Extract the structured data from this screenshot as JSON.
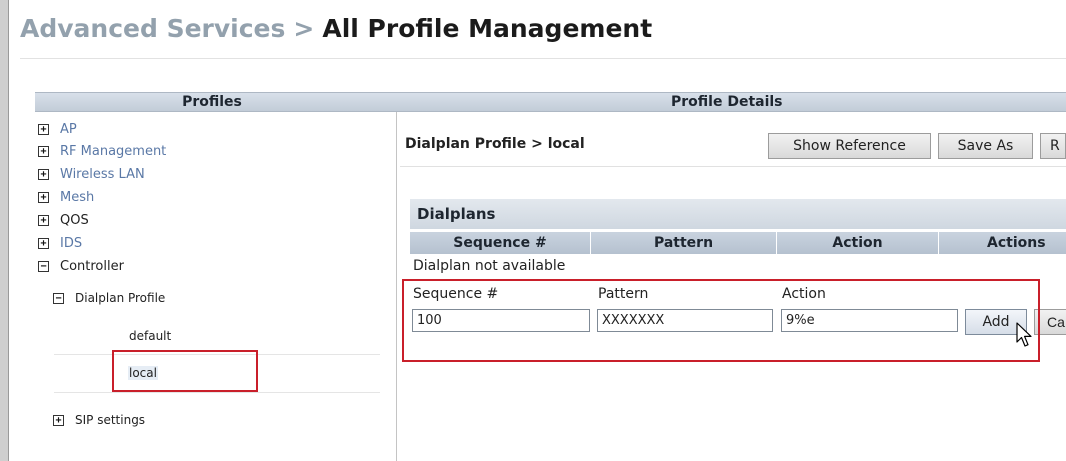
{
  "page": {
    "breadcrumb_parent": "Advanced Services",
    "breadcrumb_separator": ">",
    "title": "All Profile Management"
  },
  "profiles_panel": {
    "header": "Profiles",
    "tree": [
      {
        "label": "AP",
        "toggle": "+"
      },
      {
        "label": "RF Management",
        "toggle": "+"
      },
      {
        "label": "Wireless LAN",
        "toggle": "+"
      },
      {
        "label": "Mesh",
        "toggle": "+"
      },
      {
        "label": "QOS",
        "toggle": "+"
      },
      {
        "label": "IDS",
        "toggle": "+"
      },
      {
        "label": "Controller",
        "toggle": "−"
      }
    ],
    "dialplan_profile": {
      "label": "Dialplan Profile",
      "toggle": "−"
    },
    "dialplan_leaves": [
      "default",
      "local"
    ],
    "sip_settings": {
      "label": "SIP settings",
      "toggle": "+"
    }
  },
  "details_panel": {
    "header": "Profile Details",
    "profile_path": "Dialplan Profile > local",
    "buttons": {
      "show_reference": "Show Reference",
      "save_as": "Save As",
      "reset_partial": "R"
    },
    "section_title": "Dialplans",
    "columns": [
      "Sequence #",
      "Pattern",
      "Action",
      "Actions"
    ],
    "empty_message": "Dialplan not available",
    "form": {
      "sequence_label": "Sequence #",
      "pattern_label": "Pattern",
      "action_label": "Action",
      "sequence_value": "100",
      "pattern_value": "XXXXXXX",
      "action_value": "9%e",
      "add_label": "Add",
      "cancel_partial": "Ca"
    }
  },
  "colors": {
    "highlight": "#c91f2a",
    "link": "#5a78a6",
    "header_bg": "#c2ccd8"
  }
}
